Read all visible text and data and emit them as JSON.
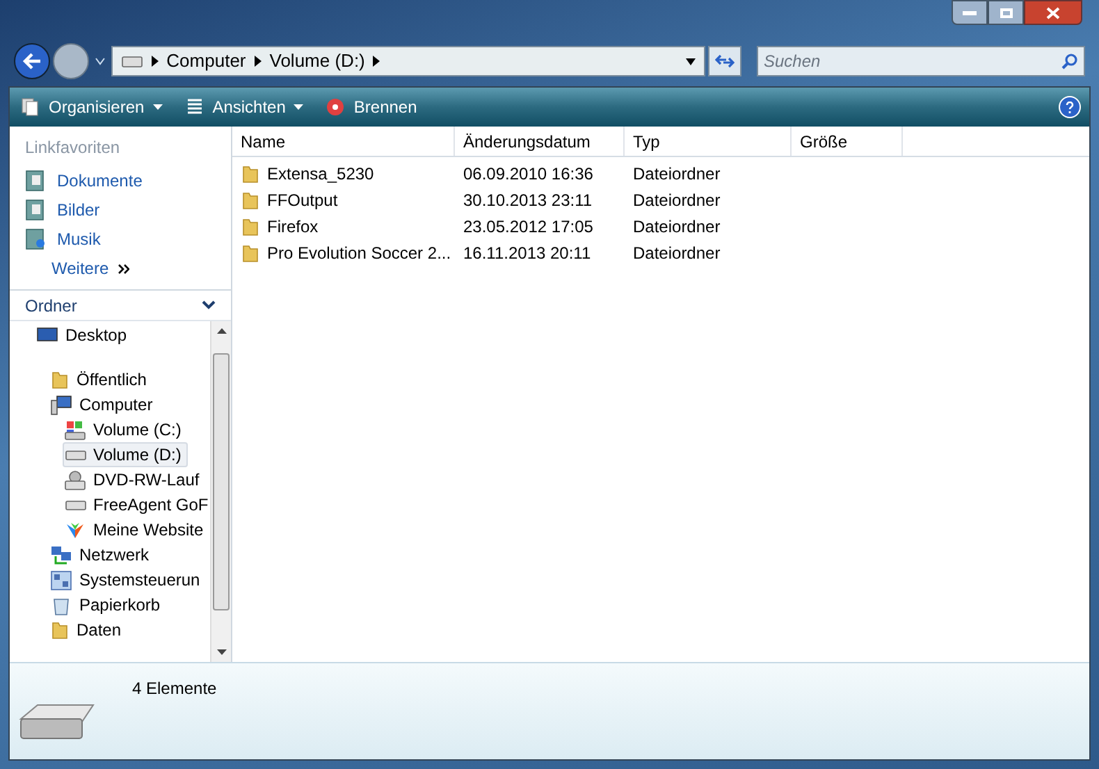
{
  "address": {
    "crumbs": [
      "Computer",
      "Volume (D:)"
    ]
  },
  "search": {
    "placeholder": "Suchen"
  },
  "toolbar": {
    "buttons": [
      {
        "label": "Organisieren",
        "kind": "menu"
      },
      {
        "label": "Ansichten",
        "kind": "menu"
      },
      {
        "label": "Brennen",
        "kind": "burn"
      }
    ]
  },
  "favorites": {
    "title": "Linkfavoriten",
    "items": [
      {
        "label": "Dokumente",
        "kind": "docs"
      },
      {
        "label": "Bilder",
        "kind": "pics"
      },
      {
        "label": "Musik",
        "kind": "music"
      }
    ],
    "more": "Weitere"
  },
  "folders": {
    "title": "Ordner",
    "tree": [
      {
        "label": "Desktop",
        "kind": "desktop",
        "selected": false,
        "children": [
          {
            "label": "Öffentlich",
            "kind": "folder",
            "selected": false
          },
          {
            "label": "Computer",
            "kind": "computer",
            "selected": false,
            "children": [
              {
                "label": "Volume (C:)",
                "kind": "windrive",
                "selected": false
              },
              {
                "label": "Volume (D:)",
                "kind": "drive",
                "selected": true
              },
              {
                "label": "DVD-RW-Lauf",
                "kind": "dvd",
                "selected": false
              },
              {
                "label": "FreeAgent GoF",
                "kind": "drive",
                "selected": false
              },
              {
                "label": "Meine Website",
                "kind": "web",
                "selected": false
              }
            ]
          },
          {
            "label": "Netzwerk",
            "kind": "network",
            "selected": false
          },
          {
            "label": "Systemsteuerun",
            "kind": "control",
            "selected": false
          },
          {
            "label": "Papierkorb",
            "kind": "bin",
            "selected": false
          },
          {
            "label": "Daten",
            "kind": "folder",
            "selected": false
          }
        ]
      }
    ]
  },
  "table": {
    "columns": [
      "Name",
      "Änderungsdatum",
      "Typ",
      "Größe"
    ],
    "rows": [
      [
        "Extensa_5230",
        "06.09.2010 16:36",
        "Dateiordner"
      ],
      [
        "FFOutput",
        "30.10.2013 23:11",
        "Dateiordner"
      ],
      [
        "Firefox",
        "23.05.2012 17:05",
        "Dateiordner"
      ],
      [
        "Pro Evolution Soccer 2...",
        "16.11.2013 20:11",
        "Dateiordner"
      ]
    ]
  },
  "details": {
    "count": "4 Elemente"
  }
}
